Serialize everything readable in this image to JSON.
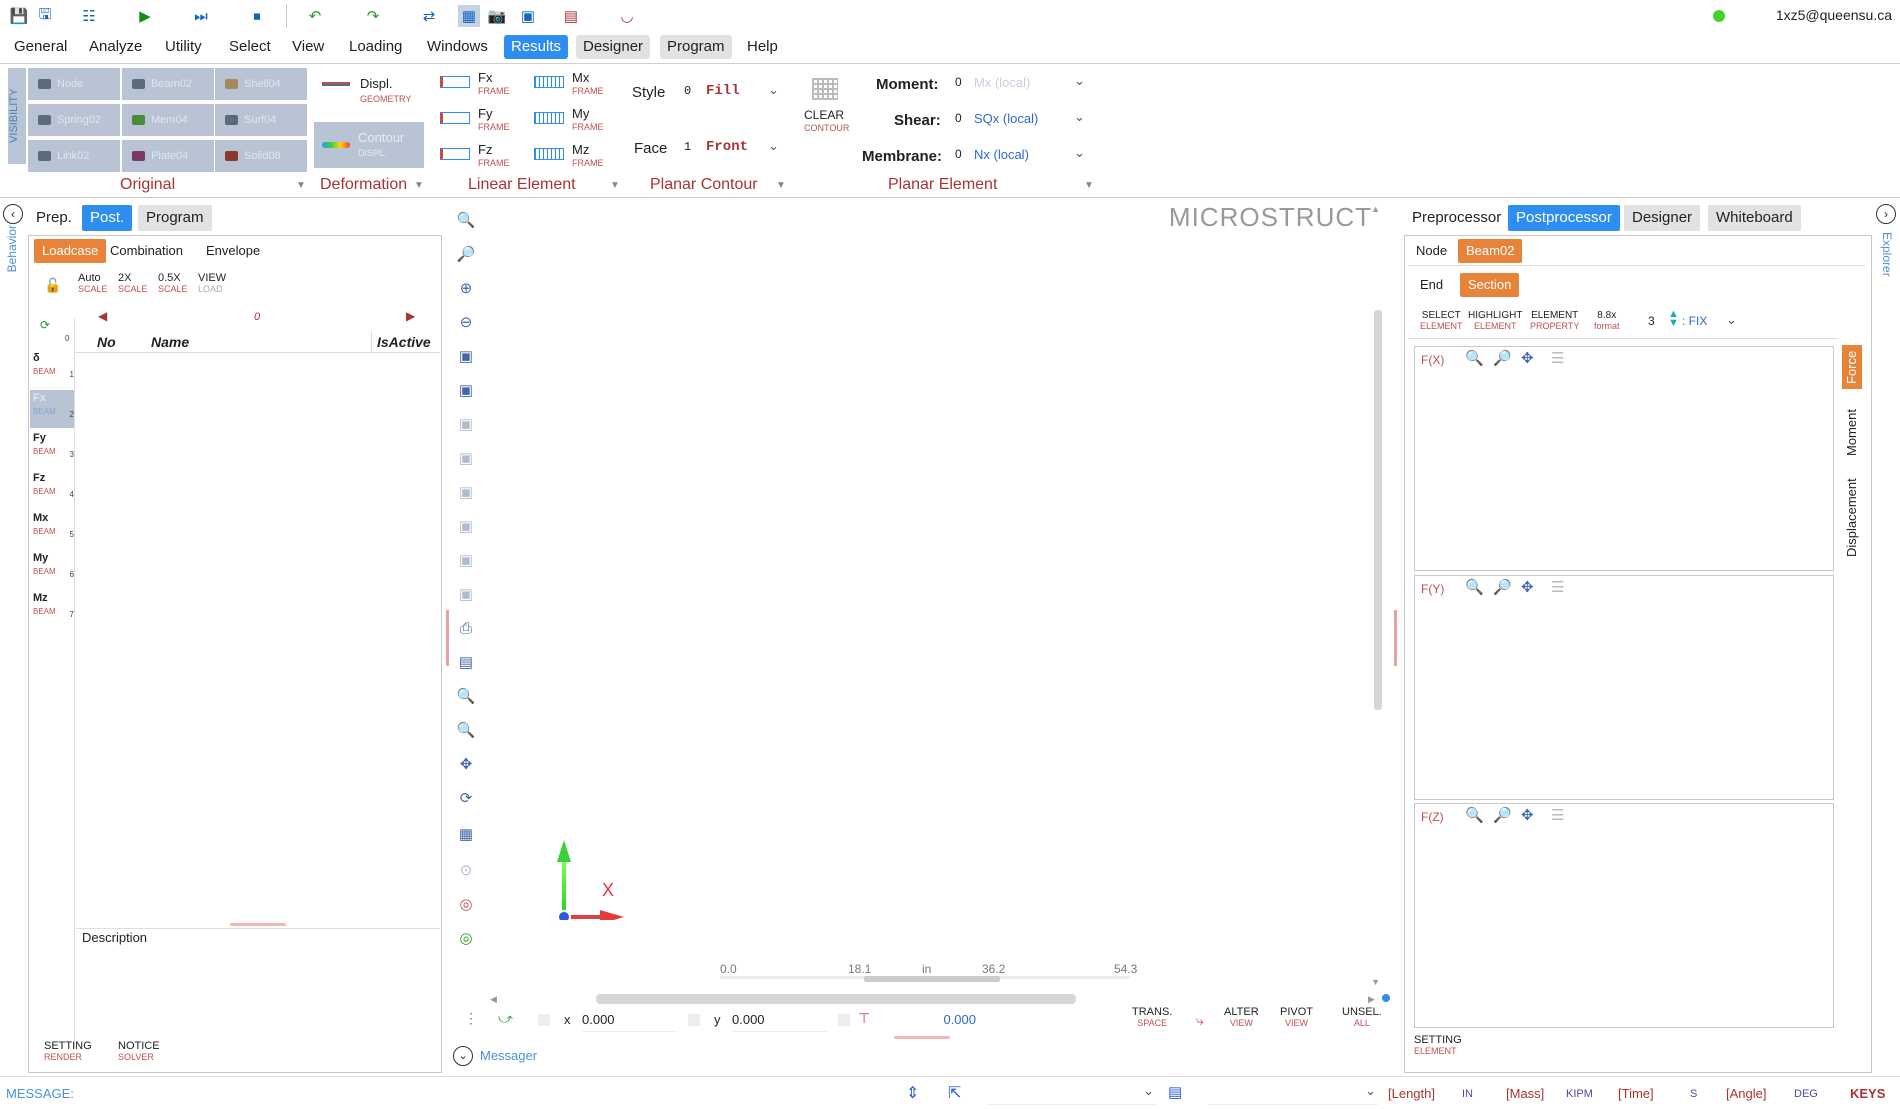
{
  "user": {
    "email": "1xz5@queensu.ca"
  },
  "menu": [
    "General",
    "Analyze",
    "Utility",
    "Select",
    "View",
    "Loading",
    "Windows",
    "Results",
    "Designer",
    "Program",
    "Help"
  ],
  "ribbon": {
    "visibility_label": "VISIBILITY",
    "vis_buttons": [
      "Node",
      "Beam02",
      "Shell04",
      "Spring02",
      "Mem04",
      "Surf04",
      "Link02",
      "Plate04",
      "Solid08"
    ],
    "displ": {
      "title": "Displ.",
      "sub": "GEOMETRY"
    },
    "contour": {
      "title": "Contour",
      "sub": "DISPL."
    },
    "linear": [
      {
        "t": "Fx",
        "s": "FRAME"
      },
      {
        "t": "Mx",
        "s": "FRAME"
      },
      {
        "t": "Fy",
        "s": "FRAME"
      },
      {
        "t": "My",
        "s": "FRAME"
      },
      {
        "t": "Fz",
        "s": "FRAME"
      },
      {
        "t": "Mz",
        "s": "FRAME"
      }
    ],
    "style": {
      "label": "Style",
      "num": "0",
      "value": "Fill"
    },
    "face": {
      "label": "Face",
      "num": "1",
      "value": "Front"
    },
    "clear": {
      "title": "CLEAR",
      "sub": "CONTOUR"
    },
    "moment": {
      "label": "Moment:",
      "num": "0",
      "value": "Mx (local)"
    },
    "shear": {
      "label": "Shear:",
      "num": "0",
      "value": "SQx (local)"
    },
    "membrane": {
      "label": "Membrane:",
      "num": "0",
      "value": "Nx (local)"
    },
    "groups": [
      "Original",
      "Deformation",
      "Linear Element",
      "Planar Contour",
      "Planar Element"
    ]
  },
  "left": {
    "behavior": "Behavior",
    "tabs": [
      "Prep.",
      "Post.",
      "Program"
    ],
    "subtabs": [
      "Loadcase",
      "Combination",
      "Envelope"
    ],
    "scale_buttons": [
      {
        "t": "Auto",
        "s": "SCALE"
      },
      {
        "t": "2X",
        "s": "SCALE"
      },
      {
        "t": "0.5X",
        "s": "SCALE"
      },
      {
        "t": "VIEW",
        "s": "LOAD"
      }
    ],
    "zero_top": "0",
    "index": "0",
    "columns": [
      "No",
      "Name",
      "IsActive"
    ],
    "loads": [
      {
        "n": "δ",
        "t": "BEAM",
        "i": "1"
      },
      {
        "n": "Fx",
        "t": "BEAM",
        "i": "2"
      },
      {
        "n": "Fy",
        "t": "BEAM",
        "i": "3"
      },
      {
        "n": "Fz",
        "t": "BEAM",
        "i": "4"
      },
      {
        "n": "Mx",
        "t": "BEAM",
        "i": "5"
      },
      {
        "n": "My",
        "t": "BEAM",
        "i": "6"
      },
      {
        "n": "Mz",
        "t": "BEAM",
        "i": "7"
      }
    ],
    "description": "Description",
    "setting": {
      "t": "SETTING",
      "s": "RENDER"
    },
    "notice": {
      "t": "NOTICE",
      "s": "SOLVER"
    }
  },
  "canvas": {
    "brand": "MICROSTRUCT",
    "axis_x": "X",
    "ruler": [
      "0.0",
      "18.1",
      "in",
      "36.2",
      "54.3"
    ],
    "x_label": "x",
    "x_value": "0.000",
    "y_label": "y",
    "y_value": "0.000",
    "dist_value": "0.000",
    "trans": {
      "t": "TRANS.",
      "s": "SPACE"
    },
    "alter": {
      "t": "ALTER",
      "s": "VIEW"
    },
    "pivot": {
      "t": "PIVOT",
      "s": "VIEW"
    },
    "unsel": {
      "t": "UNSEL.",
      "s": "ALL"
    },
    "messager": "Messager"
  },
  "right": {
    "explorer": "Explorer",
    "tabs": [
      "Preprocessor",
      "Postprocessor",
      "Designer",
      "Whiteboard"
    ],
    "subtabs": [
      "Node",
      "Beam02"
    ],
    "subtabs2": [
      "End",
      "Section"
    ],
    "tools": [
      {
        "t": "SELECT",
        "s": "ELEMENT"
      },
      {
        "t": "HIGHLIGHT",
        "s": "ELEMENT"
      },
      {
        "t": "ELEMENT",
        "s": "PROPERTY"
      },
      {
        "t": "8.8x",
        "s": "format"
      }
    ],
    "fix_num": "3",
    "fix_label": ": FIX",
    "plots": [
      "F(X)",
      "F(Y)",
      "F(Z)"
    ],
    "side_tabs": [
      "Force",
      "Moment",
      "Displacement"
    ],
    "setting": {
      "t": "SETTING",
      "s": "ELEMENT"
    }
  },
  "status": {
    "message": "MESSAGE:",
    "length": "[Length]",
    "length_u": "IN",
    "mass": "[Mass]",
    "mass_u": "KIPM",
    "time": "[Time]",
    "time_u": "S",
    "angle": "[Angle]",
    "angle_u": "DEG",
    "keys": "KEYS"
  }
}
